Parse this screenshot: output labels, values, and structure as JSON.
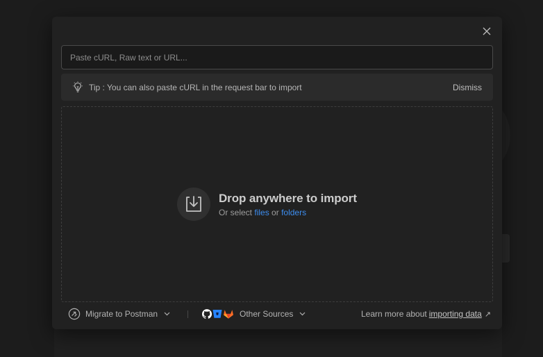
{
  "modal": {
    "paste_input": {
      "value": "",
      "placeholder": "Paste cURL, Raw text or URL..."
    },
    "tip": {
      "text": "Tip : You can also paste cURL in the request bar to import",
      "dismiss_label": "Dismiss"
    },
    "dropzone": {
      "title": "Drop anywhere to import",
      "sub_prefix": "Or select",
      "files_link": "files",
      "sub_or": "or",
      "folders_link": "folders"
    },
    "footer": {
      "migrate_label": "Migrate to Postman",
      "other_sources_label": "Other Sources",
      "learn_prefix": "Learn more about",
      "learn_link": "importing data",
      "learn_arrow": "↗"
    }
  },
  "icons": {
    "close": "close-icon",
    "tip": "lightbulb-icon",
    "drop": "import-tray-icon",
    "migrate": "migrate-icon",
    "sources": [
      "github-icon",
      "bitbucket-icon",
      "gitlab-icon"
    ]
  },
  "colors": {
    "link": "#3d8ef0",
    "github": "#ffffff",
    "bitbucket": "#2684ff",
    "gitlab": "#fc6d26"
  }
}
